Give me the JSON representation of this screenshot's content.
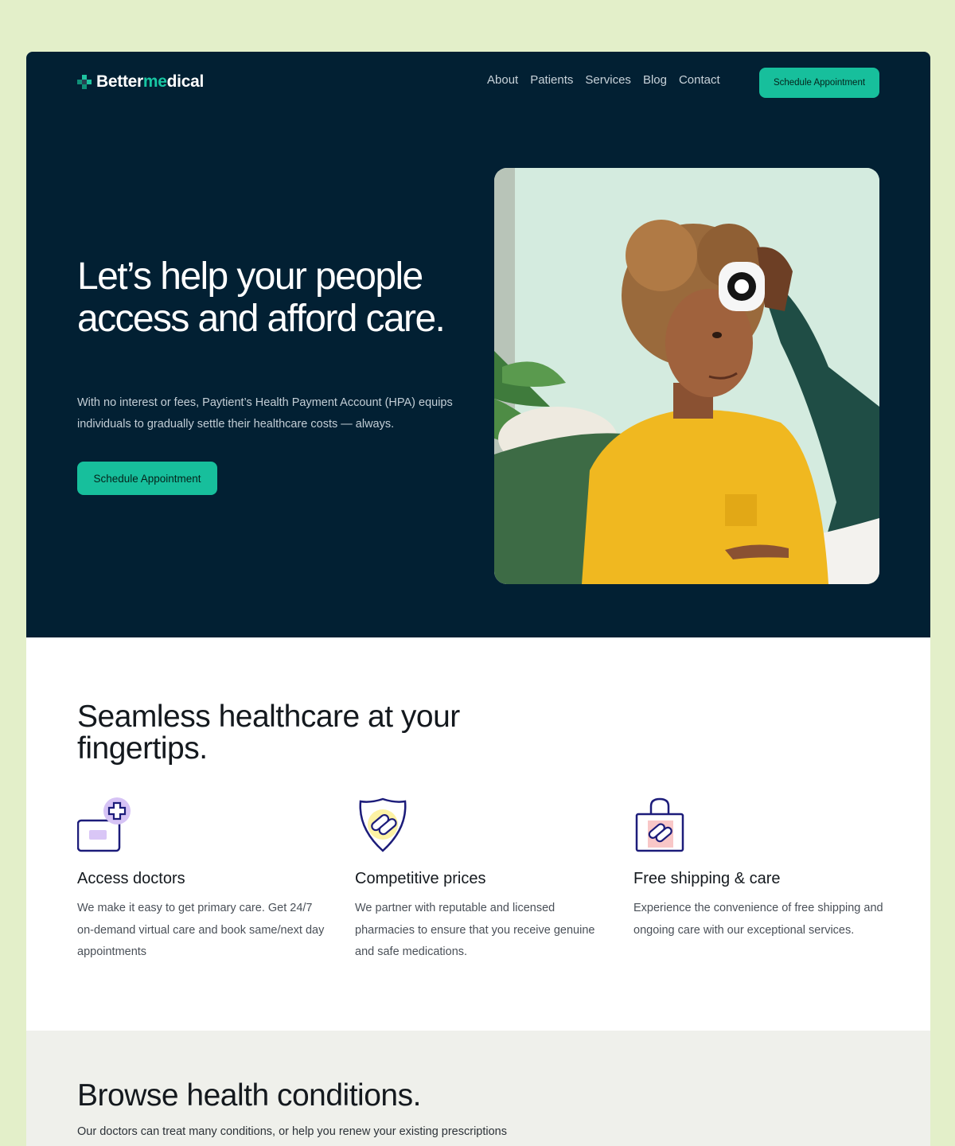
{
  "brand": {
    "name_part1": "Better",
    "name_part2": "me",
    "name_part3": "dical",
    "accent_color": "#17bf9c",
    "dark_color": "#022033"
  },
  "nav": {
    "items": [
      "About",
      "Patients",
      "Services",
      "Blog",
      "Contact"
    ],
    "cta_label": "Schedule Appointment"
  },
  "hero": {
    "title": "Let’s help your people access and afford care.",
    "subtitle": "With no interest or fees, Paytient’s Health Payment Account (HPA) equips individuals to gradually settle their healthcare costs — always.",
    "cta_label": "Schedule Appointment"
  },
  "features": {
    "title": "Seamless healthcare at your fingertips.",
    "items": [
      {
        "icon": "doctor-card-icon",
        "title": "Access doctors",
        "text": "We make it easy to get primary care. Get 24/7 on-demand virtual care and book same/next day appointments"
      },
      {
        "icon": "shield-pills-icon",
        "title": "Competitive prices",
        "text": "We partner with reputable and licensed pharmacies to ensure that you receive genuine and safe medications."
      },
      {
        "icon": "shopping-bag-pills-icon",
        "title": "Free shipping & care",
        "text": "Experience the convenience of free shipping and ongoing care with our exceptional services."
      }
    ]
  },
  "browse": {
    "title": "Browse health conditions.",
    "subtitle": "Our doctors can treat many conditions, or help you renew your existing prescriptions"
  }
}
